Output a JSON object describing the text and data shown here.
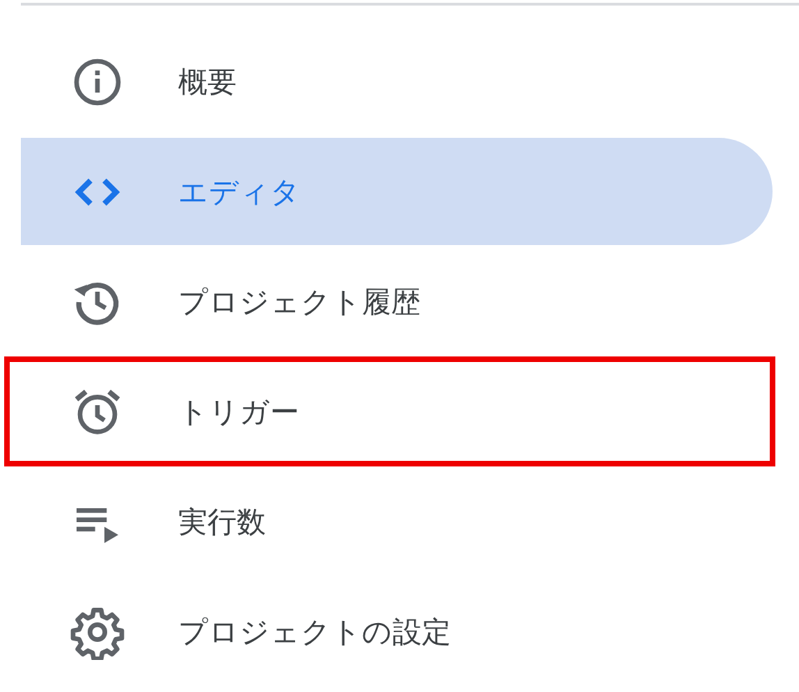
{
  "menu": [
    {
      "label": "概要",
      "selected": false,
      "highlighted": false
    },
    {
      "label": "エディタ",
      "selected": true,
      "highlighted": false
    },
    {
      "label": "プロジェクト履歴",
      "selected": false,
      "highlighted": false
    },
    {
      "label": "トリガー",
      "selected": false,
      "highlighted": true
    },
    {
      "label": "実行数",
      "selected": false,
      "highlighted": false
    },
    {
      "label": "プロジェクトの設定",
      "selected": false,
      "highlighted": false
    }
  ]
}
